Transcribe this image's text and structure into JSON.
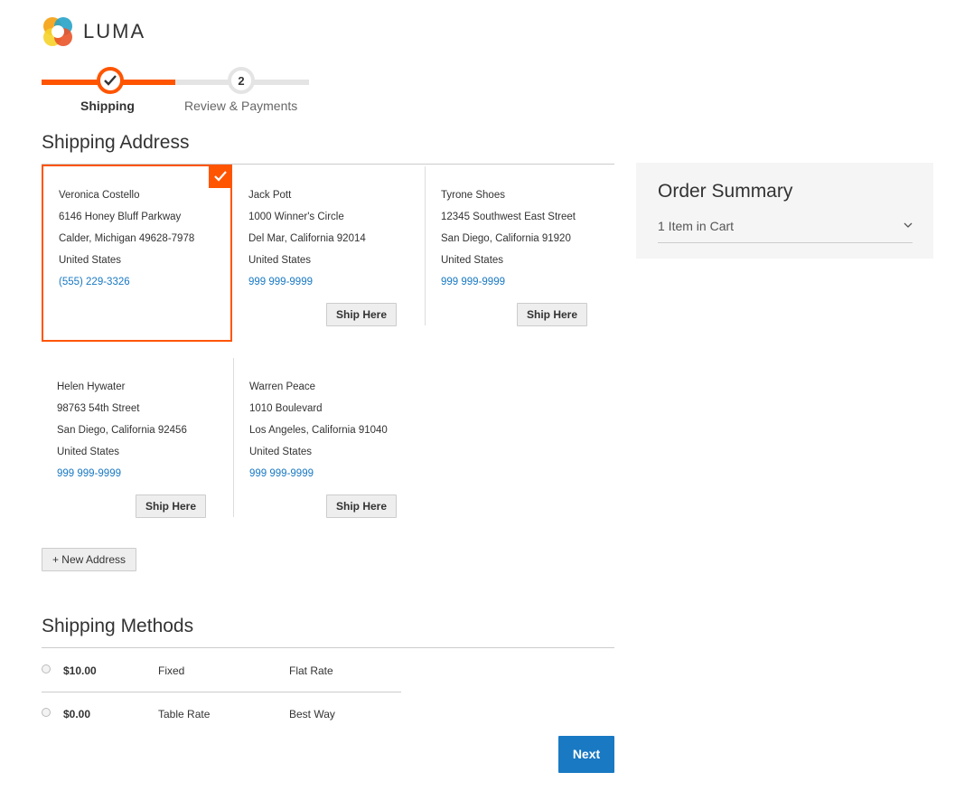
{
  "brand": {
    "name": "LUMA"
  },
  "progress": {
    "steps": [
      {
        "label": "Shipping",
        "number": "",
        "state": "complete"
      },
      {
        "label": "Review & Payments",
        "number": "2",
        "state": "pending"
      }
    ]
  },
  "shipping_address": {
    "title": "Shipping Address",
    "addresses": [
      {
        "name": "Veronica Costello",
        "street": "6146 Honey Bluff Parkway",
        "city": "Calder, Michigan 49628-7978",
        "country": "United States",
        "phone": "(555) 229-3326",
        "selected": true,
        "button": ""
      },
      {
        "name": "Jack Pott",
        "street": "1000 Winner's Circle",
        "city": "Del Mar, California 92014",
        "country": "United States",
        "phone": "999 999-9999",
        "selected": false,
        "button": "Ship Here"
      },
      {
        "name": "Tyrone Shoes",
        "street": "12345 Southwest East Street",
        "city": "San Diego, California 91920",
        "country": "United States",
        "phone": "999 999-9999",
        "selected": false,
        "button": "Ship Here"
      },
      {
        "name": "Helen Hywater",
        "street": "98763 54th Street",
        "city": "San Diego, California 92456",
        "country": "United States",
        "phone": "999 999-9999",
        "selected": false,
        "button": "Ship Here"
      },
      {
        "name": "Warren Peace",
        "street": "1010 Boulevard",
        "city": "Los Angeles, California 91040",
        "country": "United States",
        "phone": "999 999-9999",
        "selected": false,
        "button": "Ship Here"
      }
    ],
    "new_address_label": "+ New Address"
  },
  "shipping_methods": {
    "title": "Shipping Methods",
    "methods": [
      {
        "price": "$10.00",
        "method": "Fixed",
        "carrier": "Flat Rate"
      },
      {
        "price": "$0.00",
        "method": "Table Rate",
        "carrier": "Best Way"
      }
    ]
  },
  "order_summary": {
    "title": "Order Summary",
    "items_in_cart": "1 Item in Cart"
  },
  "actions": {
    "next_label": "Next"
  },
  "colors": {
    "accent": "#ff5501",
    "link": "#1979c3",
    "primary_button": "#1979c3"
  },
  "icons": {
    "step_complete": "checkmark-icon",
    "address_selected": "checkmark-icon",
    "summary_toggle": "chevron-down-icon"
  }
}
